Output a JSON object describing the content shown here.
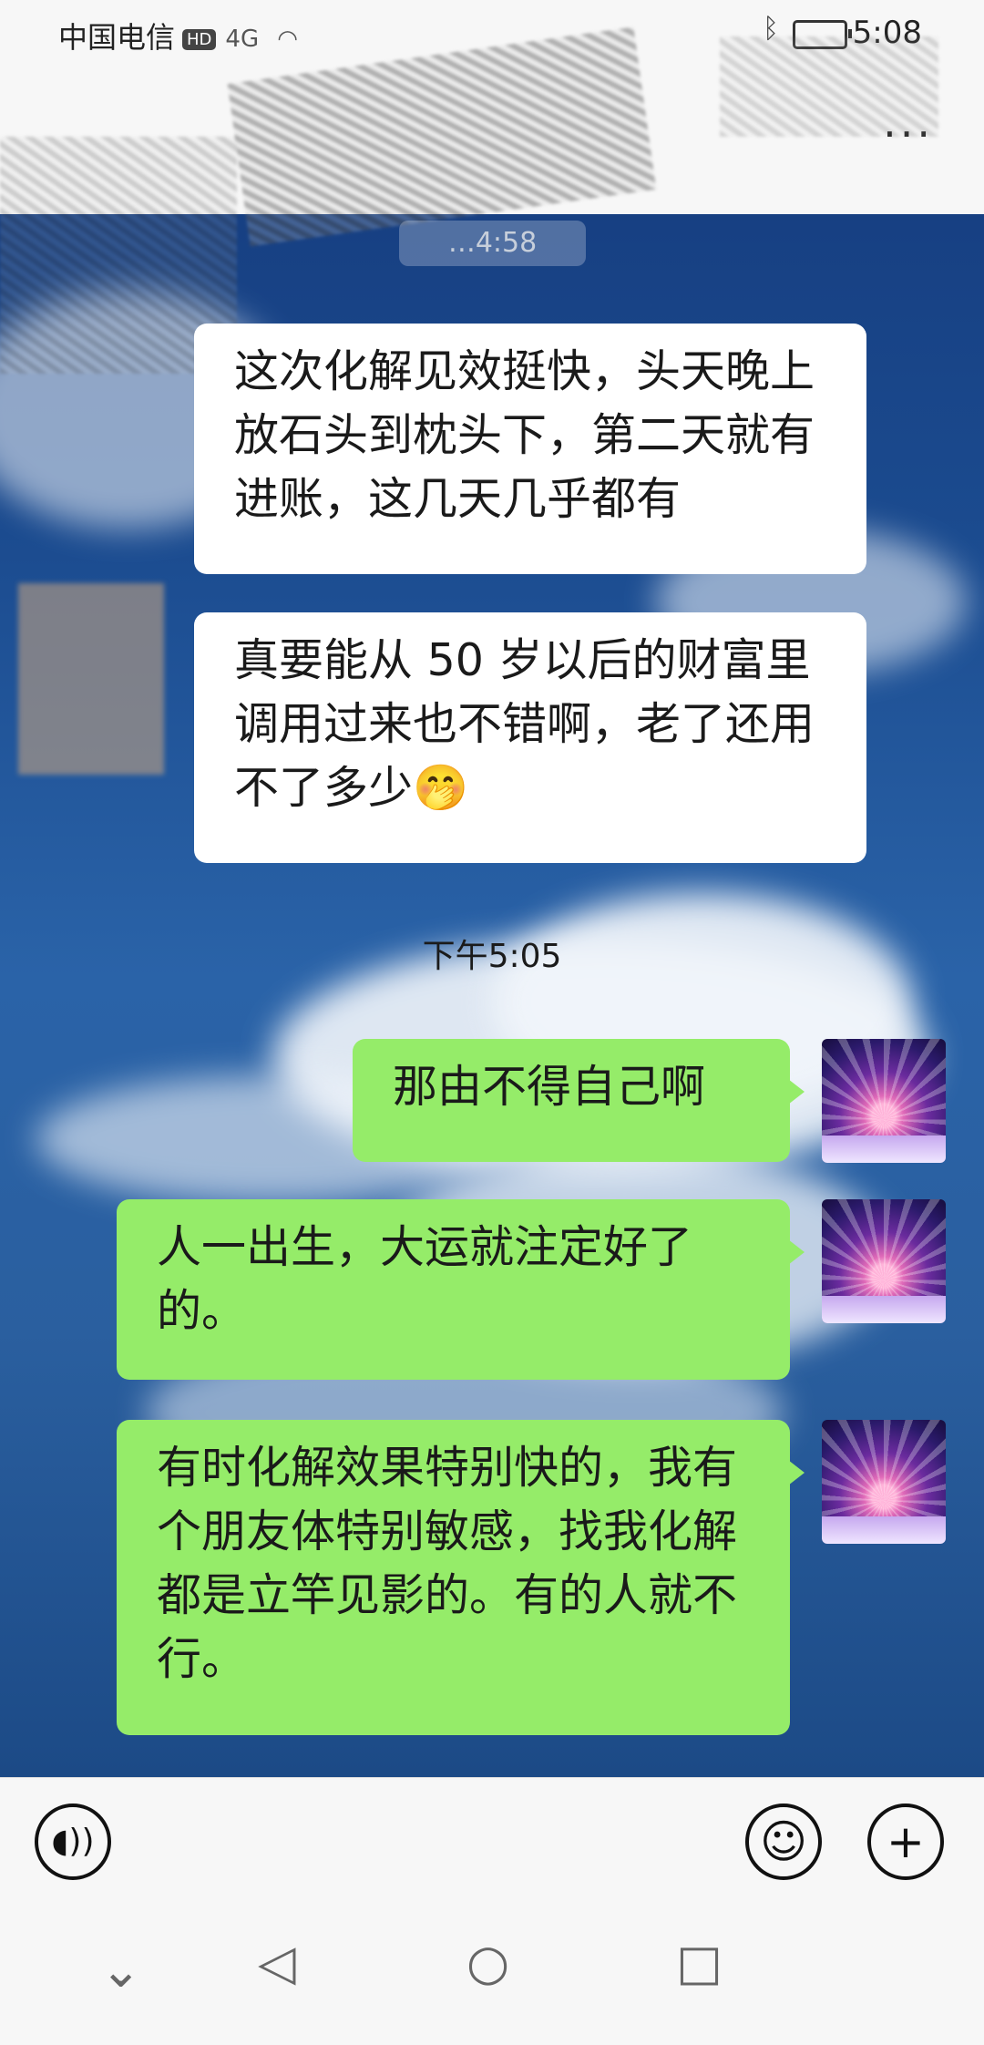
{
  "status_bar": {
    "carrier": "中国电信",
    "hd": "HD",
    "signal": "4G",
    "time": "5:08"
  },
  "header": {
    "more_icon": "more-dots-icon",
    "more_label": "···"
  },
  "chat": {
    "date_pill": "…4:58",
    "messages": [
      {
        "side": "in",
        "text": "这次化解见效挺快，头天晚上放石头到枕头下，第二天就有进账，这几天几乎都有"
      },
      {
        "side": "in",
        "text": "真要能从 50 岁以后的财富里调用过来也不错啊，老了还用不了多少🤭"
      },
      {
        "side": "out",
        "text": "那由不得自己啊"
      },
      {
        "side": "out",
        "text": "人一出生，大运就注定好了的。"
      },
      {
        "side": "out",
        "text": "有时化解效果特别快的，我有个朋友体特别敏感，找我化解都是立竿见影的。有的人就不行。"
      }
    ],
    "timestamp": "下午5:05"
  },
  "input_bar": {
    "voice_icon": "voice-icon",
    "emoji_icon": "emoji-icon",
    "plus_icon": "plus-icon"
  },
  "nav_bar": {
    "back_icon": "back-triangle-icon",
    "home_icon": "home-circle-icon",
    "recents_icon": "recents-square-icon",
    "collapse_icon": "chevron-down-icon"
  }
}
